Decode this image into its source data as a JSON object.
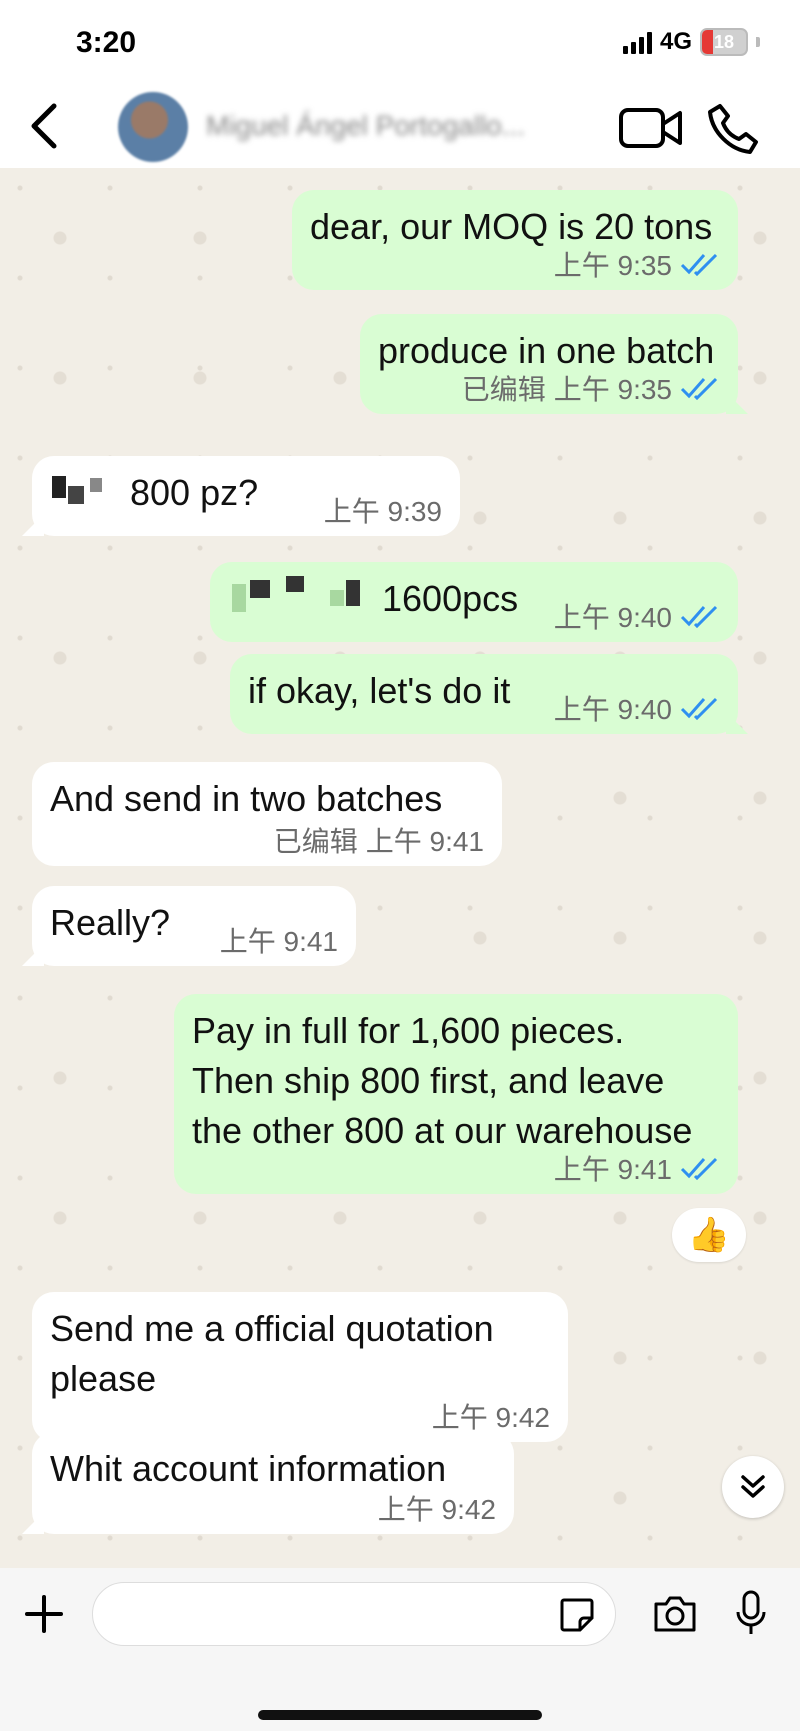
{
  "status_bar": {
    "time": "3:20",
    "network": "4G",
    "battery": "18"
  },
  "header": {
    "contact_name": "Miguel Ángel Portogallo..."
  },
  "messages": [
    {
      "direction": "out",
      "text": "dear, our MOQ is 20 tons",
      "time": "上午 9:35",
      "status": "read"
    },
    {
      "direction": "out",
      "text": "produce in one batch",
      "edited": "已编辑",
      "time": "上午 9:35",
      "status": "read"
    },
    {
      "direction": "in",
      "text": "800 pz?",
      "time": "上午 9:39"
    },
    {
      "direction": "out",
      "text": "1600pcs",
      "time": "上午 9:40",
      "status": "read"
    },
    {
      "direction": "out",
      "text": "if okay, let's do it",
      "time": "上午 9:40",
      "status": "read"
    },
    {
      "direction": "in",
      "text": "And send in two batches",
      "edited": "已编辑",
      "time": "上午 9:41"
    },
    {
      "direction": "in",
      "text": "Really?",
      "time": "上午 9:41"
    },
    {
      "direction": "out",
      "lines": [
        "Pay in full for 1,600 pieces.",
        "Then ship 800 first, and leave",
        "the other 800 at our warehouse"
      ],
      "time": "上午 9:41",
      "status": "read",
      "reaction": "👍"
    },
    {
      "direction": "in",
      "lines": [
        "Send me a official quotation",
        "please"
      ],
      "time": "上午 9:42"
    },
    {
      "direction": "in",
      "text": "Whit account information",
      "time": "上午 9:42"
    }
  ],
  "composer": {
    "placeholder": ""
  },
  "colors": {
    "outgoing_bubble": "#d9fdd3",
    "incoming_bubble": "#ffffff",
    "read_ticks": "#2f8ff0",
    "battery_low": "#e53935"
  }
}
